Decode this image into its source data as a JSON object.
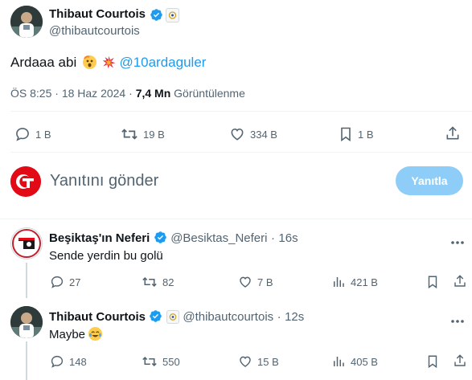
{
  "main_tweet": {
    "author_name": "Thibaut Courtois",
    "author_handle": "@thibautcourtois",
    "text_prefix": "Ardaaa abi",
    "mention": "@10ardaguler",
    "time": "ÖS 8:25",
    "separator": "·",
    "date": "18 Haz 2024",
    "views_count": "7,4 Mn",
    "views_label": "Görüntülenme",
    "stats": {
      "replies": "1 B",
      "retweets": "19 B",
      "likes": "334 B",
      "bookmarks": "1 B"
    }
  },
  "composer": {
    "placeholder": "Yanıtını gönder",
    "reply_label": "Yanıtla"
  },
  "replies": [
    {
      "author_name": "Beşiktaş'ın Neferi",
      "author_handle": "@Besiktas_Neferi",
      "time": "16s",
      "text": "Sende yerdin bu golü",
      "stats": {
        "replies": "27",
        "retweets": "82",
        "likes": "7 B",
        "views": "421 B"
      }
    },
    {
      "author_name": "Thibaut Courtois",
      "author_handle": "@thibautcourtois",
      "time": "12s",
      "text": "Maybe",
      "stats": {
        "replies": "148",
        "retweets": "550",
        "likes": "15 B",
        "views": "405 B"
      }
    }
  ],
  "colors": {
    "accent": "#1d9bf0",
    "reply_button": "#8ecdf8",
    "muted_text": "#536471"
  }
}
